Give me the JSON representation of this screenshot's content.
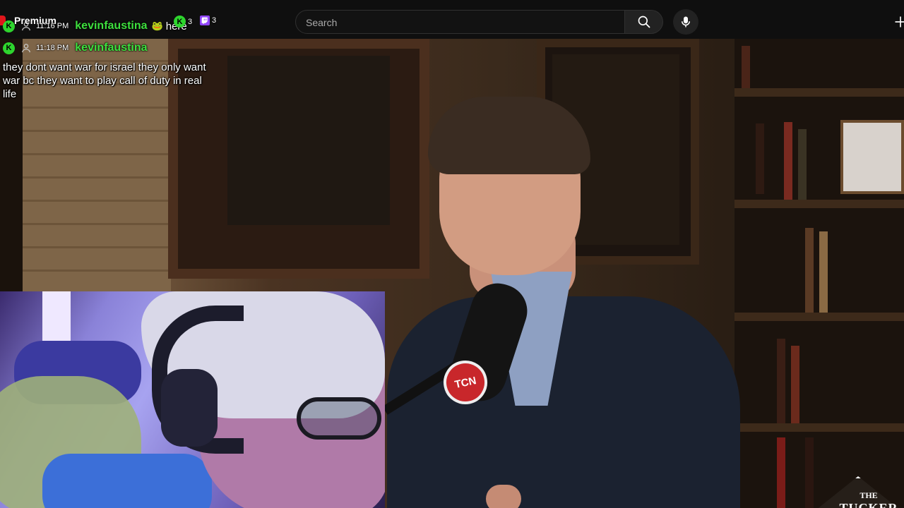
{
  "header": {
    "search_placeholder": "Search",
    "search_icon": "search-icon",
    "mic_icon": "microphone-icon",
    "create_icon": "plus-icon"
  },
  "chat_overlay": {
    "premium_label": "Premium",
    "message_1": {
      "time": "11:16 PM",
      "username": "kevinfaustina",
      "emote": "🐸",
      "text": "here",
      "badge_counts": [
        "3",
        "3"
      ]
    },
    "message_2": {
      "time": "11:18 PM",
      "username": "kevinfaustina",
      "text": "they dont want war for israel they only want war bc they want to play call of duty in real life"
    },
    "colors": {
      "username": "#3ee03e",
      "kick_badge": "#2ed52e",
      "twitch_badge": "#9146ff"
    }
  },
  "video": {
    "mic_badge": "TCN",
    "logo_line1": "THE",
    "logo_line2": "TUCKER"
  }
}
